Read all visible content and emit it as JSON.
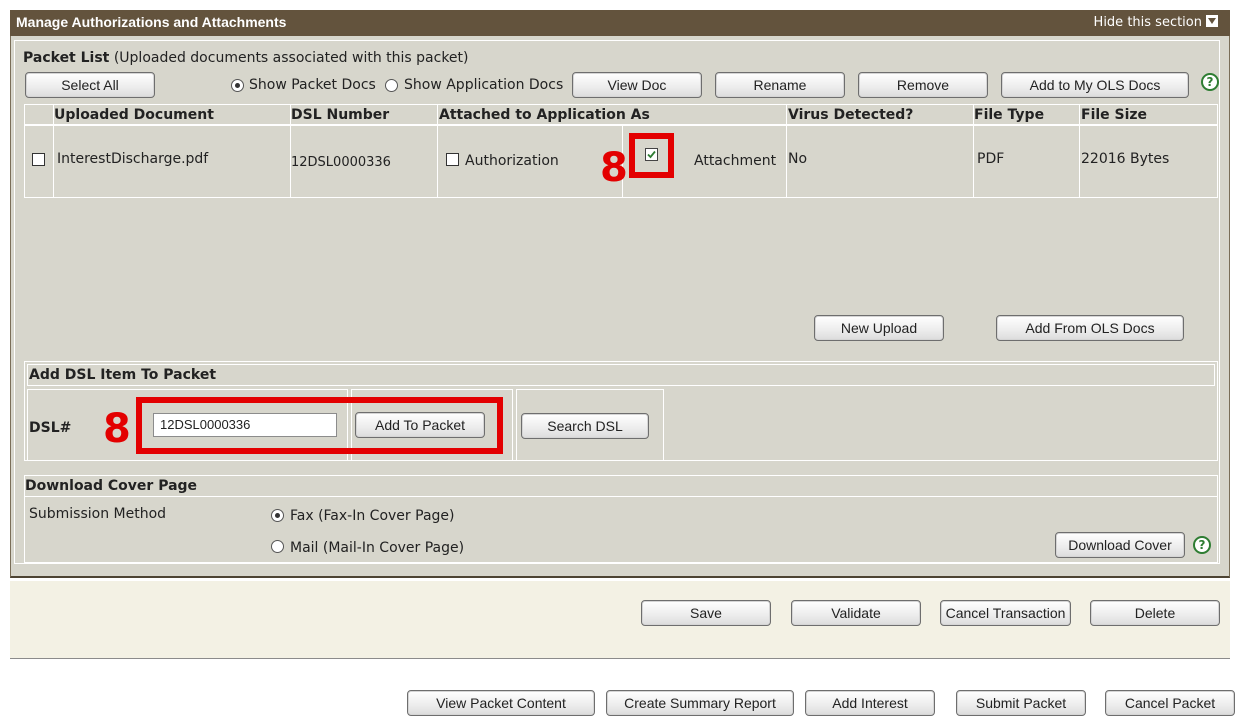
{
  "section": {
    "title": "Manage Authorizations and Attachments",
    "hide_label": "Hide this section"
  },
  "packet_list": {
    "heading": "Packet List",
    "subheading": "(Uploaded documents associated with this packet)",
    "select_all": "Select All",
    "radio_packet_docs": "Show Packet Docs",
    "radio_application_docs": "Show Application Docs",
    "view_doc": "View Doc",
    "rename": "Rename",
    "remove": "Remove",
    "add_to_ols": "Add to My OLS Docs",
    "help": "?",
    "columns": [
      "Uploaded Document",
      "DSL Number",
      "Attached to Application As",
      "Virus Detected?",
      "File Type",
      "File Size"
    ],
    "rows": [
      {
        "document": "InterestDischarge.pdf",
        "dsl": "12DSL0000336",
        "authorization_label": "Authorization",
        "attachment_label": "Attachment",
        "attachment_checked": true,
        "virus": "No",
        "file_type": "PDF",
        "file_size": "22016 Bytes"
      }
    ],
    "new_upload": "New Upload",
    "add_from_ols": "Add From OLS Docs"
  },
  "add_dsl": {
    "heading": "Add DSL Item To Packet",
    "label": "DSL#",
    "input_value": "12DSL0000336",
    "add_to_packet": "Add To Packet",
    "search_dsl": "Search DSL"
  },
  "cover": {
    "heading": "Download Cover Page",
    "submission_label": "Submission Method",
    "fax": "Fax (Fax-In Cover Page)",
    "mail": "Mail (Mail-In Cover Page)",
    "download_cover": "Download Cover",
    "help": "?"
  },
  "annotations": {
    "marker_1": "8",
    "marker_2": "8",
    "marker_color": "#e30000"
  },
  "actions": {
    "save": "Save",
    "validate": "Validate",
    "cancel_transaction": "Cancel Transaction",
    "delete": "Delete"
  },
  "footer": {
    "view_packet_content": "View Packet Content",
    "create_summary_report": "Create Summary Report",
    "add_interest": "Add Interest",
    "submit_packet": "Submit Packet",
    "cancel_packet": "Cancel Packet"
  },
  "colors": {
    "header_bg": "#63533d",
    "panel_bg": "#d7d6cc",
    "action_bar_bg": "#f3f1e4",
    "accent_red": "#e30000",
    "help_green": "#2e7d32"
  }
}
